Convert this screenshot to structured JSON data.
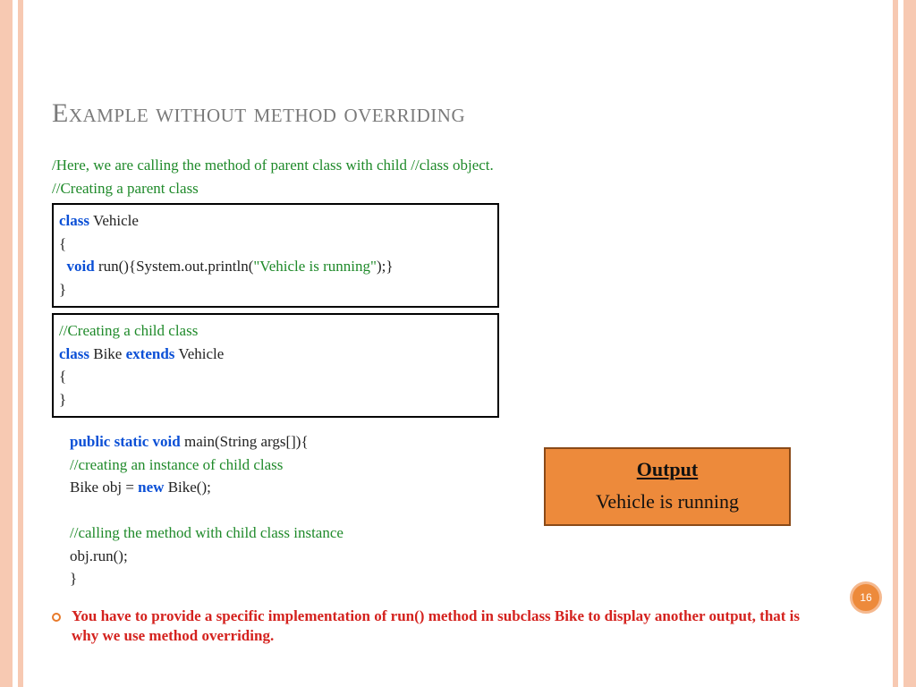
{
  "title": "Example without method overriding",
  "comments": {
    "top1": "/Here, we are calling the method of parent class with child  //class object.",
    "top2": "//Creating a parent class",
    "child": "//Creating a child class",
    "inst": "//creating an instance of child class",
    "call": "//calling the method with child class instance"
  },
  "kw": {
    "class": "class",
    "void": "void",
    "extends": "extends",
    "psv": "public static void",
    "new": "new"
  },
  "code": {
    "vehicle_name": " Vehicle",
    "open_brace": "{",
    "close_brace": "}",
    "run_mid": " run(){System.out.println(",
    "run_str": "\"Vehicle is running\"",
    "run_end": ");}",
    "bike_name": " Bike ",
    "extends_target": " Vehicle",
    "main_sig": " main(String args[]){",
    "bike_decl_a": "Bike obj = ",
    "bike_decl_b": " Bike();",
    "obj_run": "obj.run();"
  },
  "note": "You have to provide a specific implementation of run() method in subclass Bike to display another output, that is why we use method overriding.",
  "output": {
    "heading": "Output",
    "value": "Vehicle is running"
  },
  "page_number": "16"
}
